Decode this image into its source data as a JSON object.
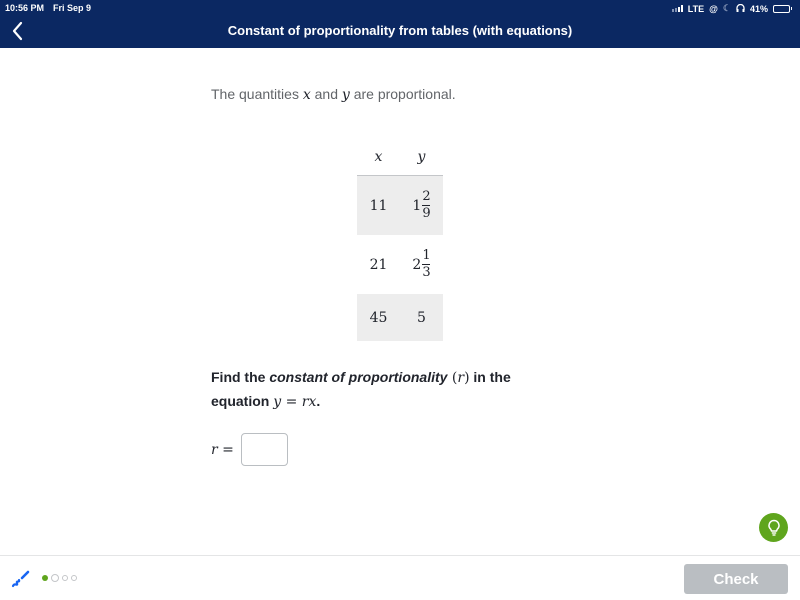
{
  "status_bar": {
    "time": "10:56 PM",
    "date": "Fri Sep 9",
    "network": "LTE",
    "battery_percent_text": "41%",
    "battery_level": 0.41,
    "icons": [
      "signal-icon",
      "at-icon",
      "moon-icon",
      "headphones-icon",
      "battery-icon"
    ]
  },
  "header": {
    "title": "Constant of proportionality from tables (with equations)",
    "back_icon": "chevron-left-icon"
  },
  "problem": {
    "intro_prefix": "The quantities ",
    "var_x": "x",
    "intro_and": " and ",
    "var_y": "y",
    "intro_suffix": " are proportional.",
    "table": {
      "headers": [
        "x",
        "y"
      ],
      "rows": [
        {
          "x": "11",
          "y_whole": "1",
          "y_num": "2",
          "y_den": "9"
        },
        {
          "x": "21",
          "y_whole": "2",
          "y_num": "1",
          "y_den": "3"
        },
        {
          "x": "45",
          "y": "5"
        }
      ]
    },
    "question": {
      "prefix": "Find the ",
      "emphasis": "constant of proportionality",
      "paren_open": " (",
      "var_r": "r",
      "paren_close": ")",
      "middle": " in the equation ",
      "equation": "y = rx",
      "suffix": "."
    },
    "answer": {
      "label_var": "r",
      "label_eq": " =",
      "value": "",
      "placeholder": ""
    }
  },
  "footer": {
    "scratchpad_icon": "scratchpad-pen-icon",
    "progress": {
      "current": 1,
      "total": 4
    },
    "check_label": "Check",
    "hint_icon": "lightbulb-icon"
  },
  "colors": {
    "header_bg": "#0b2862",
    "accent_green": "#5fa51d",
    "check_disabled": "#babec2",
    "row_shade": "#ededed"
  }
}
